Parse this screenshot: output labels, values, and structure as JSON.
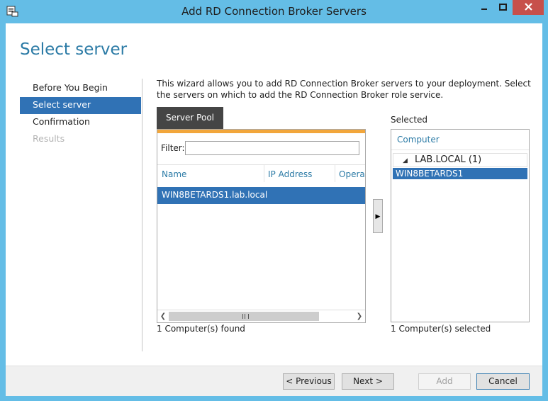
{
  "window": {
    "title": "Add RD Connection Broker Servers",
    "accent_color": "#64bde6"
  },
  "page": {
    "title": "Select server",
    "description": "This wizard allows you to add RD Connection Broker servers to your deployment. Select the servers on which to add the RD Connection Broker role service."
  },
  "nav": {
    "items": [
      {
        "label": "Before You Begin",
        "state": "normal"
      },
      {
        "label": "Select server",
        "state": "active"
      },
      {
        "label": "Confirmation",
        "state": "normal"
      },
      {
        "label": "Results",
        "state": "disabled"
      }
    ]
  },
  "server_pool": {
    "tab_label": "Server Pool",
    "filter_label": "Filter:",
    "filter_value": "",
    "columns": [
      "Name",
      "IP Address",
      "Operat"
    ],
    "rows": [
      {
        "name": "WIN8BETARDS1.lab.local",
        "ip": "",
        "os": "",
        "selected": true
      }
    ],
    "status": "1 Computer(s) found"
  },
  "selected": {
    "label": "Selected",
    "column": "Computer",
    "group": "LAB.LOCAL (1)",
    "items": [
      "WIN8BETARDS1"
    ],
    "status": "1 Computer(s) selected"
  },
  "footer": {
    "previous": "< Previous",
    "next": "Next >",
    "add": "Add",
    "cancel": "Cancel"
  }
}
